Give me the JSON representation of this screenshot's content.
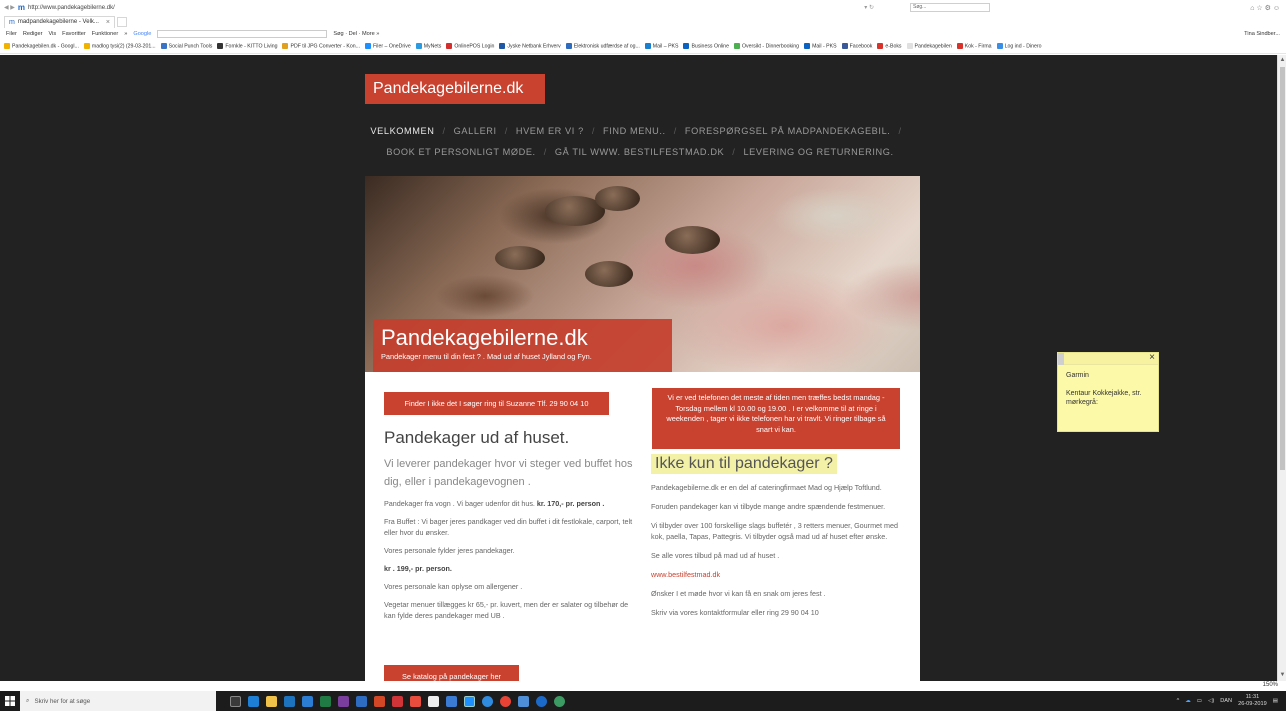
{
  "browser": {
    "url": "http://www.pandekagebilerne.dk/",
    "url_search_placeholder": "Søg...",
    "tab_title": "madpandekagebilerne - Velk...",
    "menu": [
      "Filer",
      "Rediger",
      "Vis",
      "Favoritter",
      "Funktioner",
      "»"
    ],
    "google_label": "Google",
    "toolbar_right": "Søg · Del · More »",
    "favorites": [
      "Pandekagebilen.dk - Googl...",
      "madlog tysi(2) (29-03-201...",
      "Social Punch Tools",
      "Fornkle - KITTO Living",
      "PDF til JPG Converter - Kon...",
      "Filer – OneDrive",
      "MyNets",
      "OnlinePOS Login",
      "Jyske Netbank Erhverv",
      "Elektronisk udfærdse af og...",
      "Mail – PKS",
      "Business Online",
      "Oversikt - Dinnerbooking",
      "Mail - PKS",
      "Facebook",
      "e-Boks",
      "Pandekagebilen",
      "Kok - Firma",
      "Log ind - Dinero"
    ],
    "user_label": "Tina Sindber...",
    "zoom": "150%"
  },
  "site": {
    "logo": "Pandekagebilerne.dk",
    "nav_row1": [
      "VELKOMMEN",
      "GALLERI",
      "HVEM ER VI ?",
      "FIND MENU..",
      "FORESPØRGSEL PÅ MADPANDEKAGEBIL."
    ],
    "nav_row2": [
      "BOOK ET PERSONLIGT MØDE.",
      "GÅ TIL WWW. BESTILFESTMAD.DK",
      "LEVERING OG RETURNERING."
    ],
    "hero_title": "Pandekagebilerne.dk",
    "hero_sub": "Pandekager menu til din fest ? . Mad ud af huset Jylland og Fyn.",
    "btn_call": "Finder I ikke det I søger ring til Suzanne Tlf. 29 90 04 10",
    "btn_phone_note": "Vi er ved telefonen det meste af tiden men træffes bedst mandag - Torsdag mellem kl 10.00 og 19.00 . I er velkomme til at ringe i weekenden , tager vi ikke telefonen har vi travlt. Vi ringer tilbage så snart vi kan.",
    "left": {
      "heading": "Pandekager ud af huset.",
      "lead": "Vi leverer pandekager hvor vi steger ved buffet hos dig, eller i pandekagevognen .",
      "p1_text": "Pandekager fra vogn . Vi bager udenfor dit hus.",
      "p1_price": "kr. 170,- pr. person .",
      "p2": "Fra Buffet : Vi bager jeres pandkager ved din buffet i dit festlokale, carport, telt eller hvor du ønsker.",
      "p3": "Vores personale fylder jeres pandekager.",
      "p4_price": "kr . 199,- pr. person.",
      "p5": "Vores personale kan oplyse om allergener .",
      "p6": "Vegetar menuer tillægges kr 65,- pr. kuvert, men der er salater og tilbehør de kan fylde deres pandekager med UB ."
    },
    "right": {
      "heading": "Ikke kun til pandekager ?",
      "p1": "Pandekagebilerne.dk er en del af cateringfirmaet Mad og Hjælp Toftlund.",
      "p2": "Foruden pandekager kan vi tilbyde mange andre spændende festmenuer.",
      "p3": "Vi tilbyder over 100 forskellige slags buffetér , 3 retters menuer, Gourmet med kok, paella, Tapas, Pattegris. Vi tilbyder også mad ud af huset efter ønske.",
      "p4": "Se alle vores tilbud på mad ud af huset .",
      "link": "www.bestilfestmad.dk",
      "p5": "Ønsker I et møde hvor vi kan få en snak om jeres fest .",
      "p6": "Skriv via vores kontaktformular eller ring 29 90 04 10"
    },
    "btn_catalog": "Se katalog på pandekager her"
  },
  "sticky_note": {
    "line1": "Garmin",
    "line2": "Kentaur Kokkejakke, str. mørkegrå:"
  },
  "taskbar": {
    "search_placeholder": "Skriv her for at søge",
    "lang": "DAN",
    "time": "11:31",
    "date": "26-09-2019"
  },
  "colors": {
    "brand_red": "#c9412f",
    "page_bg": "#222222",
    "sticky_yellow": "#fcf9a8"
  }
}
